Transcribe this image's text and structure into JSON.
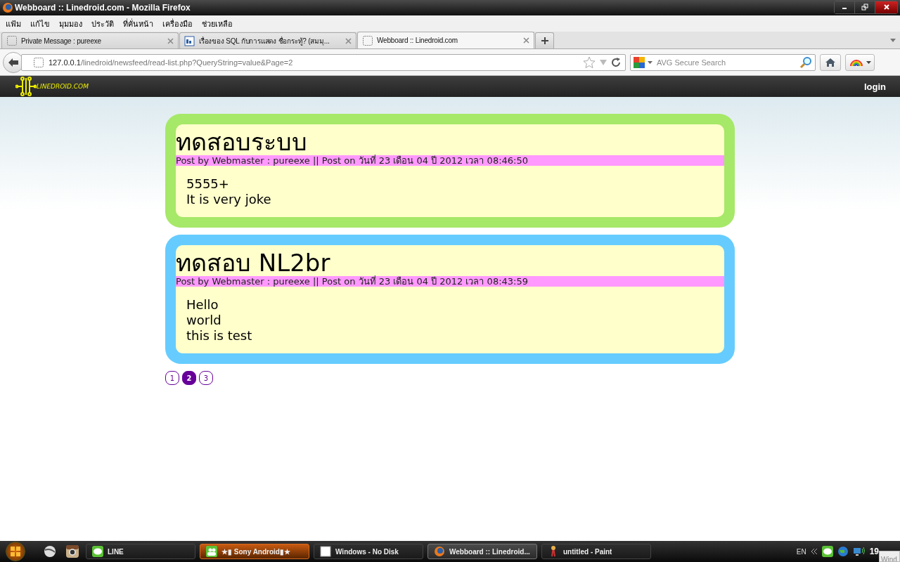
{
  "window": {
    "title": "Webboard :: Linedroid.com - Mozilla Firefox"
  },
  "menu": [
    "แฟ้ม",
    "แก้ไข",
    "มุมมอง",
    "ประวัติ",
    "ที่คั่นหน้า",
    "เครื่องมือ",
    "ช่วยเหลือ"
  ],
  "tabs": [
    {
      "label": "Private Message : pureexe",
      "selected": false,
      "kind": "blank"
    },
    {
      "label": "เรื่องของ SQL กับการแสดง ชื่อกระทู้? (สมมุ...",
      "selected": false,
      "kind": "doc"
    },
    {
      "label": "Webboard :: Linedroid.com",
      "selected": true,
      "kind": "blank"
    }
  ],
  "address_bar": {
    "host": "127.0.0.1",
    "path": "/linedroid/newsfeed/read-list.php?QueryString=value&Page=2"
  },
  "search": {
    "placeholder": "AVG Secure Search"
  },
  "site_header": {
    "logo": "LINEDROID.COM",
    "login": "login"
  },
  "posts": [
    {
      "title": "ทดสอบระบบ",
      "meta": "Post by Webmaster : pureexe || Post on วันที่ 23 เดือน 04 ปี 2012 เวลา 08:46:50",
      "body": [
        "5555+",
        "It is very joke"
      ],
      "color": "#a6e868"
    },
    {
      "title": "ทดสอบ NL2br",
      "meta": "Post by Webmaster : pureexe || Post on วันที่ 23 เดือน 04 ปี 2012 เวลา 08:43:59",
      "body": [
        "Hello",
        "world",
        "this is test"
      ],
      "color": "#66ccff"
    }
  ],
  "pagination": [
    {
      "label": "1",
      "selected": false
    },
    {
      "label": "2",
      "selected": true
    },
    {
      "label": "3",
      "selected": false
    }
  ],
  "taskbar": {
    "items": [
      {
        "label": "LINE",
        "selected": false,
        "kind": "line"
      },
      {
        "label": "★▮ Sony Android▮★",
        "selected": false,
        "kind": "contacts"
      },
      {
        "label": "Windows - No Disk",
        "selected": false,
        "kind": "window"
      },
      {
        "label": "Webboard :: Linedroid...",
        "selected": true,
        "kind": "firefox"
      },
      {
        "label": "untitled - Paint",
        "selected": false,
        "kind": "paint"
      }
    ],
    "language": "EN",
    "clock": "19",
    "popup": "Wind"
  }
}
